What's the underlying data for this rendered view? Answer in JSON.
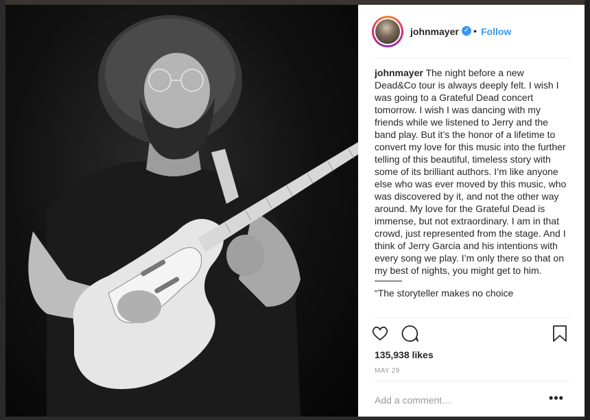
{
  "post": {
    "username": "johnmayer",
    "verified_icon": "verified-badge-icon",
    "separator": "•",
    "follow_label": "Follow",
    "caption": {
      "username": "johnmayer",
      "text": "The night before a new Dead&Co tour is always deeply felt. I wish I was going to a Grateful Dead concert tomorrow. I wish I was dancing with my friends while we listened to Jerry and the band play. But it’s the honor of a lifetime to convert my love for this music into the further telling of this beautiful, timeless story with some of its brilliant authors. I’m like anyone else who was ever moved by this music, who was discovered by it, and not the other way around. My love for the Grateful Dead is immense, but not extraordinary. I am in that crowd, just represented from the stage. And I think of Jerry Garcia and his intentions with every song we play. I’m only there so that on my best of nights, you might get to him.",
      "quote_start": "“The storyteller makes no choice"
    },
    "likes": "135,938 likes",
    "date": "MAY 29",
    "comment_placeholder": "Add a comment…",
    "more_label": "•••"
  },
  "icons": {
    "like": "heart-icon",
    "comment": "comment-icon",
    "save": "bookmark-icon"
  },
  "colors": {
    "accent": "#3897f0",
    "text": "#262626",
    "muted": "#999999"
  }
}
